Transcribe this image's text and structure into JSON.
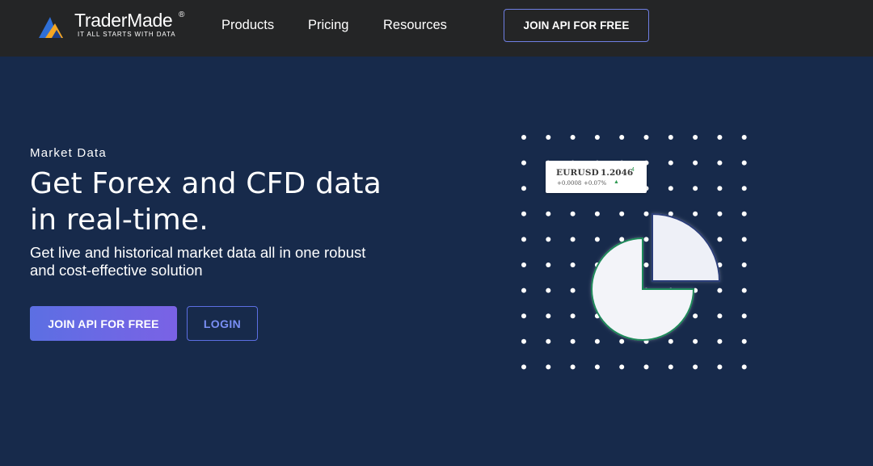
{
  "brand": {
    "name": "TraderMade",
    "registered": "®",
    "tagline": "IT ALL STARTS WITH DATA",
    "colors": {
      "logo_blue": "#2f6fd6",
      "logo_orange": "#f5a623",
      "logo_navy": "#1d3f8a"
    }
  },
  "nav": {
    "items": [
      {
        "label": "Products"
      },
      {
        "label": "Pricing"
      },
      {
        "label": "Resources"
      }
    ],
    "cta_label": "JOIN API FOR FREE"
  },
  "hero": {
    "eyebrow": "Market Data",
    "headline_line1": "Get Forex and CFD data",
    "headline_line2": "in real-time.",
    "subhead_line1": "Get live and historical market data all in one robust",
    "subhead_line2": "and cost-effective solution",
    "primary_button": "JOIN API FOR FREE",
    "secondary_button": "LOGIN"
  },
  "quote_card": {
    "pair": "EURUSD",
    "price": "1.2046",
    "last_digit": "4",
    "change": "+0.0008",
    "change_pct": "+0.07%",
    "direction": "up",
    "direction_icon": "up-triangle-icon"
  },
  "colors": {
    "background": "#172a4b",
    "topbar": "#242526",
    "accent": "#5c6fe3",
    "accent_gradient_end": "#7a62e5",
    "pie_outline": "#1f8a5a",
    "pie_outline_slice": "#2a3c78"
  }
}
